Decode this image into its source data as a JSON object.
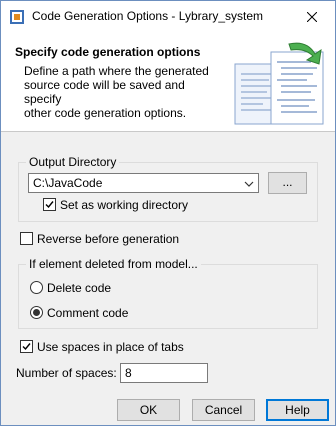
{
  "window": {
    "title": "Code Generation Options - Lybrary_system"
  },
  "header": {
    "title": "Specify code generation options",
    "description_lines": [
      "Define a path where the generated",
      "source code will be saved and specify",
      "other code generation options."
    ]
  },
  "output_directory": {
    "group_label": "Output Directory",
    "path_value": "C:\\JavaCode",
    "browse_label": "...",
    "working_dir_label": "Set as working directory",
    "working_dir_checked": true
  },
  "reverse": {
    "label": "Reverse before generation",
    "checked": false
  },
  "element_deleted": {
    "group_label": "If element deleted from model...",
    "options": [
      {
        "label": "Delete code",
        "selected": false
      },
      {
        "label": "Comment code",
        "selected": true
      }
    ]
  },
  "spaces": {
    "label": "Use spaces in place of tabs",
    "checked": true,
    "count_label": "Number of spaces:",
    "count_value": "8"
  },
  "buttons": {
    "ok": "OK",
    "cancel": "Cancel",
    "help": "Help"
  },
  "icons": {
    "app": "magicdraw-app-icon",
    "close": "close-icon",
    "dropdown": "chevron-down-icon",
    "illustration": "code-generation-illustration"
  },
  "colors": {
    "window_border": "#6c8fbf",
    "default_button_border": "#0078d7",
    "dialog_background": "#f0f0f0"
  }
}
